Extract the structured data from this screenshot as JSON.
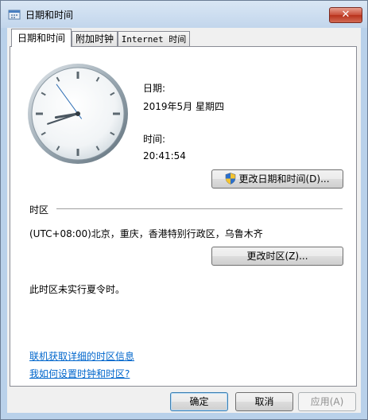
{
  "window": {
    "title": "日期和时间",
    "close_glyph": "✕"
  },
  "tabs": [
    {
      "label": "日期和时间",
      "active": true
    },
    {
      "label": "附加时钟",
      "active": false
    },
    {
      "label": "Internet 时间",
      "active": false
    }
  ],
  "date_time": {
    "date_label": "日期:",
    "date_value": "2019年5月 星期四",
    "time_label": "时间:",
    "time_value": "20:41:54",
    "change_datetime_button": "更改日期和时间(D)..."
  },
  "timezone": {
    "section_label": "时区",
    "value": "(UTC+08:00)北京，重庆，香港特别行政区，乌鲁木齐",
    "change_timezone_button": "更改时区(Z)...",
    "dst_note": "此时区未实行夏令时。"
  },
  "links": {
    "online_info": "联机获取详细的时区信息",
    "help": "我如何设置时钟和时区?"
  },
  "footer": {
    "ok_button": "确定",
    "cancel_button": "取消",
    "apply_button": "应用(A)"
  },
  "icons": {
    "title": "clock-window-icon",
    "close": "close-icon",
    "shield": "uac-shield-icon"
  },
  "clock": {
    "hours": 8,
    "minutes": 41,
    "seconds": 54
  }
}
